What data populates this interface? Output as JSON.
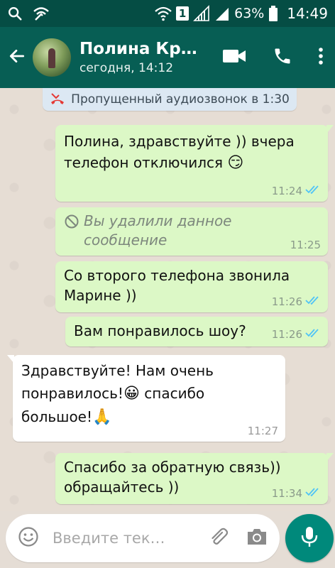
{
  "status_bar": {
    "sim_slot": "1",
    "battery": "63%",
    "time": "14:49",
    "icons": [
      "search-icon",
      "wifi-calling-icon",
      "wifi-icon",
      "signal-icon",
      "signal-icon",
      "battery-icon"
    ]
  },
  "header": {
    "contact_name": "Полина Кра…",
    "last_seen": "сегодня, 14:12",
    "actions": [
      "video-call-icon",
      "phone-icon",
      "more-menu-icon"
    ]
  },
  "chat": {
    "system_note": "Пропущенный аудиозвонок в 1:30",
    "messages": [
      {
        "direction": "out",
        "line1": "Полина, здравствуйте )) вчера",
        "line2": "телефон отключился",
        "emoji": "😏",
        "time": "11:24",
        "read": true
      },
      {
        "direction": "out",
        "line1": "Вы удалили данное",
        "line2": "сообщение",
        "time": "11:25",
        "deleted": true
      },
      {
        "direction": "out",
        "line1": "Со второго телефона звонила",
        "line2": "Марине ))",
        "time": "11:26",
        "read": true
      },
      {
        "direction": "out",
        "line1": "Вам понравилось шоу?",
        "time": "11:26",
        "read": true
      },
      {
        "direction": "in",
        "line1": "Здравствуйте! Нам очень",
        "line2a": "понравилось!",
        "emoji2": "😀",
        "line2b": " спасибо",
        "line3": "большое!",
        "emoji3": "🙏",
        "time": "11:27"
      },
      {
        "direction": "out",
        "line1": "Спасибо за обратную связь))",
        "line2": "обращайтесь ))",
        "time": "11:34",
        "read": true
      }
    ]
  },
  "composer": {
    "placeholder": "Введите тек…"
  },
  "colors": {
    "header": "#075e54",
    "status_bar": "#054d44",
    "outgoing_bubble": "#dcf8c6",
    "incoming_bubble": "#ffffff",
    "read_ticks": "#4fc3f7",
    "mic_button": "#00897b"
  }
}
